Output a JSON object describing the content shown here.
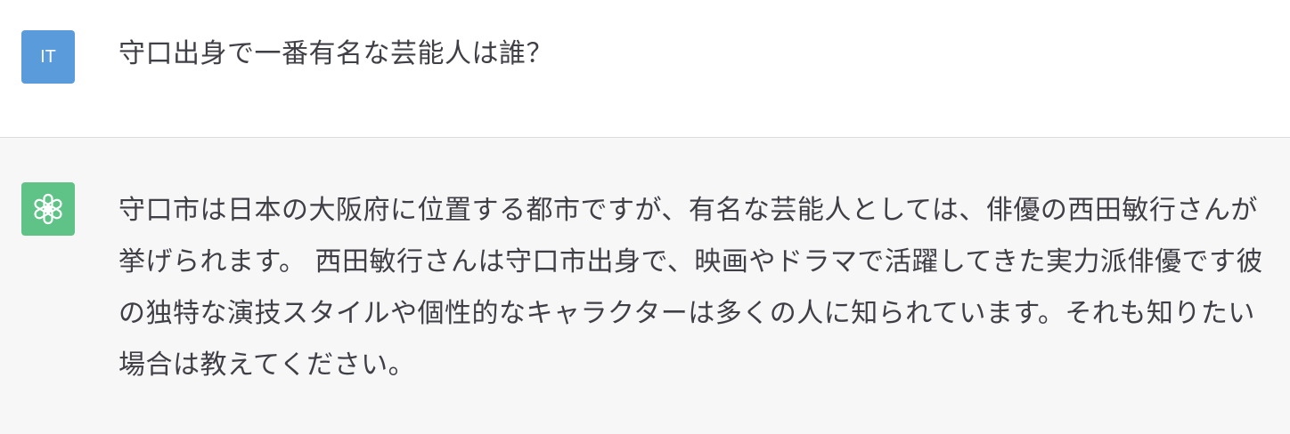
{
  "messages": {
    "user": {
      "avatar_initials": "IT",
      "text": "守口出身で一番有名な芸能人は誰？"
    },
    "assistant": {
      "avatar_icon": "openai-logo-icon",
      "text": "守口市は日本の大阪府に位置する都市ですが、有名な芸能人としては、俳優の西田敏行さんが挙げられます。 西田敏行さんは守口市出身で、映画やドラマで活躍してきた実力派俳優です彼の独特な演技スタイルや個性的なキャラクターは多くの人に知られています。それも知りたい場合は教えてください。"
    }
  },
  "colors": {
    "user_avatar_bg": "#5a9bdc",
    "assistant_avatar_bg": "#5fc287",
    "assistant_row_bg": "#f7f7f8",
    "text": "#3f3f46"
  }
}
